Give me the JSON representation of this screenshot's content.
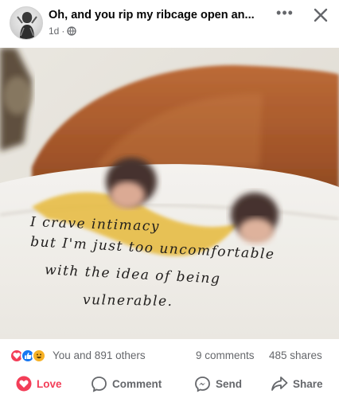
{
  "post": {
    "title": "Oh, and you rip my ribcage open an...",
    "time": "1d",
    "privacy_icon": "globe-icon"
  },
  "photo": {
    "handwriting": [
      "I  crave   intimacy",
      "but  I'm   just  too  uncomfortable",
      "with   the  idea   of  being",
      "vulnerable."
    ]
  },
  "stats": {
    "reactions": [
      "love",
      "like",
      "haha"
    ],
    "reaction_text": "You and 891 others",
    "comments": "9 comments",
    "shares": "485 shares"
  },
  "actions": {
    "love": "Love",
    "comment": "Comment",
    "send": "Send",
    "share": "Share"
  },
  "colors": {
    "love": "#f33e58",
    "like": "#1877f2",
    "haha": "#f7b125",
    "muted": "#65676b"
  }
}
